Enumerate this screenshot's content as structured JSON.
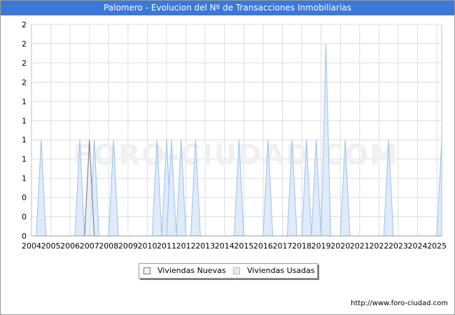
{
  "title": "Palomero - Evolucion del Nº de Transacciones Inmobiliarias",
  "watermark": "FORO-CIUDAD.COM",
  "source": "http://www.foro-ciudad.com",
  "legend": {
    "nuevas_label": "Viviendas Nuevas",
    "usadas_label": "Viviendas Usadas"
  },
  "colors": {
    "title_bg": "#3c78d8",
    "nuevas_fill": "#f2f2f2",
    "nuevas_stroke": "#777777",
    "usadas_fill": "#deebfa",
    "usadas_stroke": "#9ec0ea",
    "grid": "#dddddd"
  },
  "chart_data": {
    "type": "area",
    "x_start": 2004,
    "x_end": 2025.25,
    "x_step": 0.25,
    "xticks": [
      "2004",
      "2005",
      "2006",
      "2007",
      "2008",
      "2009",
      "2010",
      "2011",
      "2012",
      "2013",
      "2014",
      "2015",
      "2016",
      "2017",
      "2018",
      "2019",
      "2020",
      "2021",
      "2022",
      "2023",
      "2024",
      "2025"
    ],
    "ylim": [
      0,
      2.2
    ],
    "yticks": [
      0,
      0.2,
      0.4,
      0.6,
      0.8,
      1,
      1.2,
      1.4,
      1.6,
      1.8,
      2,
      2.2
    ],
    "ytick_labels": [
      "0",
      "0",
      "0",
      "1",
      "1",
      "1",
      "1",
      "1",
      "2",
      "2",
      "2",
      "2"
    ],
    "grid": true,
    "legend_position": "bottom",
    "series": [
      {
        "name": "Viviendas Nuevas",
        "points": [
          [
            2007,
            1
          ]
        ]
      },
      {
        "name": "Viviendas Usadas",
        "points": [
          [
            2004.5,
            1
          ],
          [
            2006.5,
            1
          ],
          [
            2007,
            1
          ],
          [
            2007.25,
            1
          ],
          [
            2008.25,
            1
          ],
          [
            2010.5,
            1
          ],
          [
            2011,
            1
          ],
          [
            2011.25,
            1
          ],
          [
            2011.75,
            1
          ],
          [
            2012.5,
            1
          ],
          [
            2014.75,
            1
          ],
          [
            2016.25,
            1
          ],
          [
            2017.5,
            1
          ],
          [
            2018.25,
            1
          ],
          [
            2018.75,
            1
          ],
          [
            2019.25,
            2
          ],
          [
            2020.25,
            1
          ],
          [
            2022.5,
            1
          ],
          [
            2025.25,
            1
          ]
        ]
      }
    ]
  }
}
